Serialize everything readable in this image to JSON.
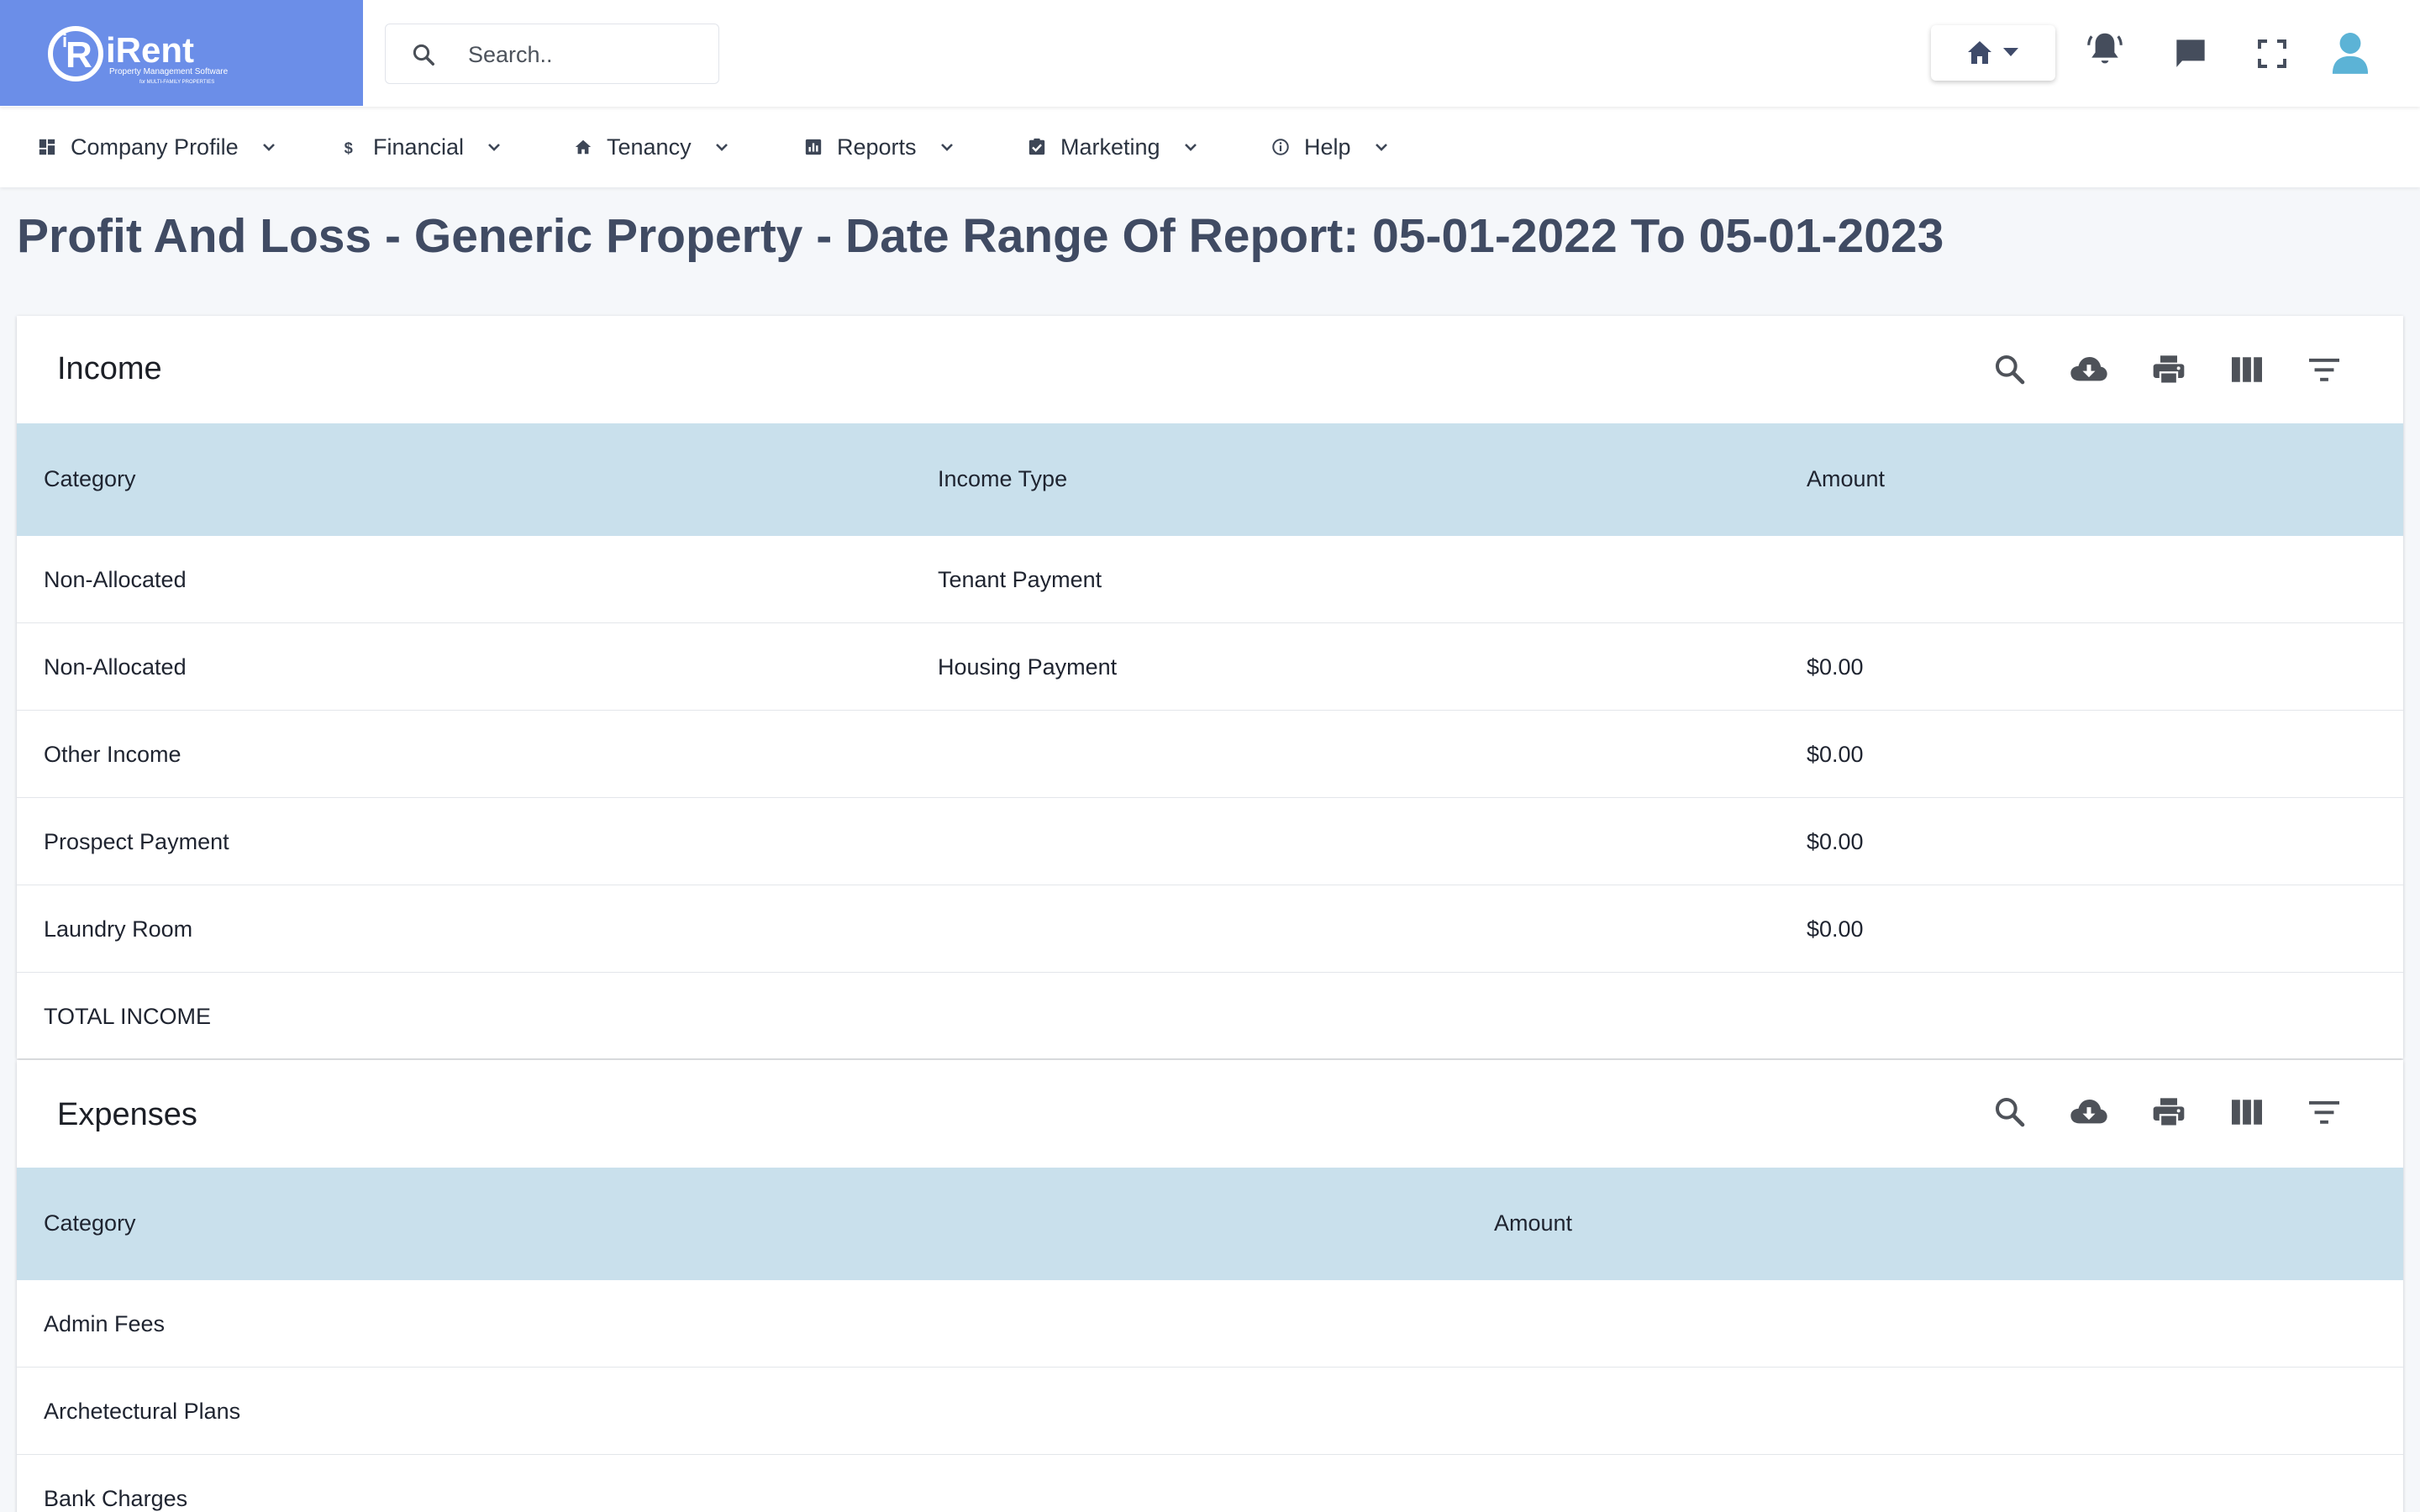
{
  "brand": {
    "name": "iRent",
    "tagline": "Property Management Software",
    "subtagline": "for MULTI-FAMILY PROPERTIES"
  },
  "search": {
    "placeholder": "Search.."
  },
  "header_icons": [
    "home-icon",
    "bell-icon",
    "chat-icon",
    "fullscreen-icon",
    "user-icon"
  ],
  "nav": {
    "items": [
      {
        "label": "Company Profile",
        "icon": "dashboard-icon"
      },
      {
        "label": "Financial",
        "icon": "dollar-icon"
      },
      {
        "label": "Tenancy",
        "icon": "home-icon"
      },
      {
        "label": "Reports",
        "icon": "chart-icon"
      },
      {
        "label": "Marketing",
        "icon": "checkbox-icon"
      },
      {
        "label": "Help",
        "icon": "info-icon"
      }
    ]
  },
  "page": {
    "title": "Profit And Loss - Generic Property - Date Range Of Report: 05-01-2022 To 05-01-2023"
  },
  "income": {
    "title": "Income",
    "columns": [
      "Category",
      "Income Type",
      "Amount"
    ],
    "rows": [
      [
        "Non-Allocated",
        "Tenant Payment",
        ""
      ],
      [
        "Non-Allocated",
        "Housing Payment",
        "$0.00"
      ],
      [
        "Other Income",
        "",
        "$0.00"
      ],
      [
        "Prospect Payment",
        "",
        "$0.00"
      ],
      [
        "Laundry Room",
        "",
        "$0.00"
      ],
      [
        "TOTAL INCOME",
        "",
        ""
      ]
    ]
  },
  "expenses": {
    "title": "Expenses",
    "columns": [
      "Category",
      "Amount"
    ],
    "rows": [
      [
        "Admin Fees",
        ""
      ],
      [
        "Archetectural Plans",
        ""
      ],
      [
        "Bank Charges",
        ""
      ]
    ]
  },
  "toolbar_icons": [
    "search-icon",
    "cloud-download-icon",
    "print-icon",
    "columns-icon",
    "filter-icon"
  ],
  "colors": {
    "brand": "#6b8ee8",
    "table_header": "#c9e0ec",
    "title": "#404b63",
    "user_icon": "#5cb3d6"
  }
}
